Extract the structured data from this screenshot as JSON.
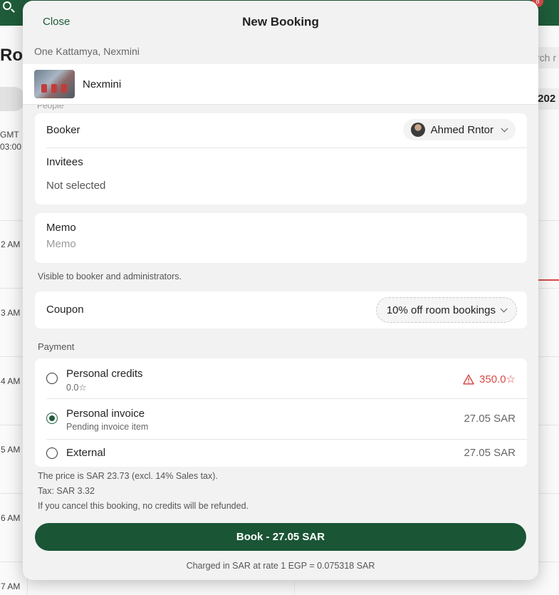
{
  "background": {
    "page_title": "Roo",
    "search_placeholder": "rch r",
    "date_label": "/202",
    "timezone": [
      "GMT",
      "03:00"
    ],
    "hours": [
      "2 AM",
      "3 AM",
      "4 AM",
      "5 AM",
      "6 AM",
      "7 AM"
    ],
    "notification_count": "8"
  },
  "modal": {
    "close_label": "Close",
    "title": "New Booking",
    "location": "One Kattamya, Nexmini",
    "room_name": "Nexmini",
    "peek_text": "People",
    "booker": {
      "label": "Booker",
      "name": "Ahmed Rntor"
    },
    "invitees": {
      "label": "Invitees",
      "value": "Not selected"
    },
    "memo": {
      "label": "Memo",
      "placeholder": "Memo",
      "value": "",
      "helper": "Visible to booker and administrators."
    },
    "coupon": {
      "label": "Coupon",
      "value": "10% off room bookings"
    },
    "payment": {
      "section_label": "Payment",
      "options": [
        {
          "title": "Personal credits",
          "subtitle": "0.0☆",
          "amount": "350.0☆",
          "selected": false,
          "warning": true
        },
        {
          "title": "Personal invoice",
          "subtitle": "Pending invoice item",
          "amount": "27.05 SAR",
          "selected": true,
          "warning": false
        },
        {
          "title": "External",
          "subtitle": "",
          "amount": "27.05 SAR",
          "selected": false,
          "warning": false
        }
      ]
    },
    "price_lines": [
      "The price is SAR 23.73 (excl. 14% Sales tax).",
      "Tax: SAR 3.32",
      "If you cancel this booking, no credits will be refunded."
    ],
    "book_button": "Book - 27.05 SAR",
    "rate_note": "Charged in SAR at rate 1 EGP = 0.075318 SAR"
  },
  "colors": {
    "brand_green": "#1a5536",
    "warning_red": "#d94a4a"
  },
  "icons": [
    "search-icon",
    "chevron-down-icon",
    "warning-icon",
    "avatar"
  ]
}
